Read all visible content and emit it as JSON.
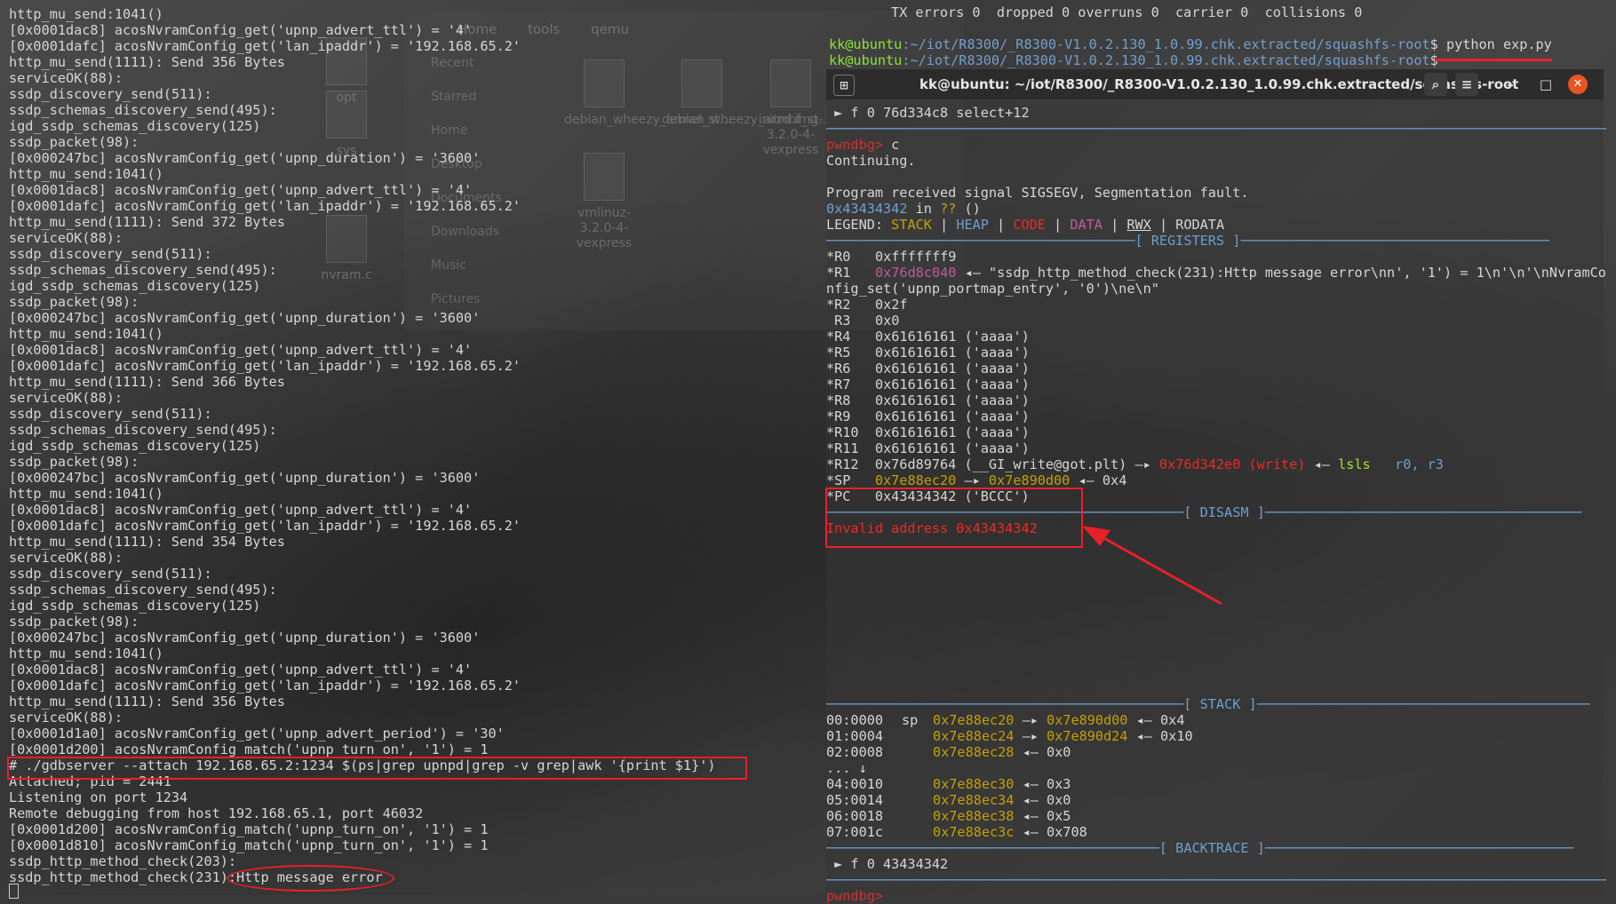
{
  "background_file_manager": {
    "tabs": [
      "Home",
      "tools",
      "qemu"
    ],
    "sidebar": [
      "Recent",
      "Starred",
      "Home",
      "Desktop",
      "Documents",
      "Downloads",
      "Music",
      "Pictures"
    ],
    "files": [
      {
        "name": "opt"
      },
      {
        "name": "sys"
      },
      {
        "name": "debian_wheezy_armel_st..."
      },
      {
        "name": "debian_wheezy_armhf_st..."
      },
      {
        "name": "initrd.img-3.2.0-4-vexpress"
      },
      {
        "name": "vmlinuz-3.2.0-4-vexpress"
      },
      {
        "name": "nvram.c"
      }
    ]
  },
  "left_terminal": {
    "lines": [
      "http_mu_send:1041()",
      "[0x0001dac8] acosNvramConfig_get('upnp_advert_ttl') = '4'",
      "[0x0001dafc] acosNvramConfig_get('lan_ipaddr') = '192.168.65.2'",
      "http_mu_send(1111): Send 356 Bytes",
      "serviceOK(88):",
      "ssdp_discovery_send(511):",
      "ssdp_schemas_discovery_send(495):",
      "igd_ssdp_schemas_discovery(125)",
      "ssdp_packet(98):",
      "[0x000247bc] acosNvramConfig_get('upnp_duration') = '3600'",
      "http_mu_send:1041()",
      "[0x0001dac8] acosNvramConfig_get('upnp_advert_ttl') = '4'",
      "[0x0001dafc] acosNvramConfig_get('lan_ipaddr') = '192.168.65.2'",
      "http_mu_send(1111): Send 372 Bytes",
      "serviceOK(88):",
      "ssdp_discovery_send(511):",
      "ssdp_schemas_discovery_send(495):",
      "igd_ssdp_schemas_discovery(125)",
      "ssdp_packet(98):",
      "[0x000247bc] acosNvramConfig_get('upnp_duration') = '3600'",
      "http_mu_send:1041()",
      "[0x0001dac8] acosNvramConfig_get('upnp_advert_ttl') = '4'",
      "[0x0001dafc] acosNvramConfig_get('lan_ipaddr') = '192.168.65.2'",
      "http_mu_send(1111): Send 366 Bytes",
      "serviceOK(88):",
      "ssdp_discovery_send(511):",
      "ssdp_schemas_discovery_send(495):",
      "igd_ssdp_schemas_discovery(125)",
      "ssdp_packet(98):",
      "[0x000247bc] acosNvramConfig_get('upnp_duration') = '3600'",
      "http_mu_send:1041()",
      "[0x0001dac8] acosNvramConfig_get('upnp_advert_ttl') = '4'",
      "[0x0001dafc] acosNvramConfig_get('lan_ipaddr') = '192.168.65.2'",
      "http_mu_send(1111): Send 354 Bytes",
      "serviceOK(88):",
      "ssdp_discovery_send(511):",
      "ssdp_schemas_discovery_send(495):",
      "igd_ssdp_schemas_discovery(125)",
      "ssdp_packet(98):",
      "[0x000247bc] acosNvramConfig_get('upnp_duration') = '3600'",
      "http_mu_send:1041()",
      "[0x0001dac8] acosNvramConfig_get('upnp_advert_ttl') = '4'",
      "[0x0001dafc] acosNvramConfig_get('lan_ipaddr') = '192.168.65.2'",
      "http_mu_send(1111): Send 356 Bytes",
      "serviceOK(88):",
      "[0x0001d1a0] acosNvramConfig_get('upnp_advert_period') = '30'",
      "[0x0001d200] acosNvramConfig_match('upnp_turn_on', '1') = 1",
      "# ./gdbserver --attach 192.168.65.2:1234 $(ps|grep upnpd|grep -v grep|awk '{print $1}')",
      "Attached; pid = 2441",
      "Listening on port 1234",
      "Remote debugging from host 192.168.65.1, port 46032",
      "[0x0001d200] acosNvramConfig_match('upnp_turn_on', '1') = 1",
      "[0x0001d810] acosNvramConfig_match('upnp_turn_on', '1') = 1",
      "ssdp_http_method_check(203):",
      "ssdp_http_method_check(231):Http message error"
    ]
  },
  "right_terminal": {
    "top_lines": [
      "TX errors 0  dropped 0 overruns 0  carrier 0  collisions 0",
      "",
      "kk@ubuntu:~/iot/R8300/_R8300-V1.0.2.130_1.0.99.chk.extracted/squashfs-root$ python exp.py",
      "kk@ubuntu:~/iot/R8300/_R8300-V1.0.2.130_1.0.99.chk.extracted/squashfs-root$"
    ],
    "prompt_user": "kk@ubuntu",
    "prompt_path": ":~/iot/R8300/_R8300-V1.0.2.130_1.0.99.chk.extracted/squashfs-root",
    "command": "python exp.py",
    "window_title": "kk@ubuntu: ~/iot/R8300/_R8300-V1.0.2.130_1.0.99.chk.extracted/squashfs-root",
    "frame_line": " ► f 0 76d334c8 select+12",
    "pwndbg_prompt": "pwndbg>",
    "continue_cmd": "c",
    "continuing": "Continuing.",
    "signal": "Program received signal SIGSEGV, Segmentation fault.",
    "fault_addr": "0x43434342",
    "fault_in": " in ",
    "fault_qq": "??",
    "fault_paren": " ()",
    "legend_label": "LEGEND: ",
    "legend": [
      "STACK",
      "HEAP",
      "CODE",
      "DATA",
      "RWX",
      "RODATA"
    ],
    "sections": {
      "registers": "[ REGISTERS ]",
      "disasm": "[ DISASM ]",
      "stack": "[ STACK ]",
      "backtrace": "[ BACKTRACE ]"
    },
    "registers": [
      {
        "name": "*R0",
        "value": "0xfffffff9",
        "rest": ""
      },
      {
        "name": "*R1",
        "value": "0x76d8c040",
        "rest": " ◂— \"ssdp_http_method_check(231):Http message error\\nn', '1') = 1\\n'\\n'\\nNvramCo"
      },
      {
        "name": "",
        "value": "",
        "rest": "nfig_set('upnp_portmap_entry', '0')\\ne\\n\""
      },
      {
        "name": "*R2",
        "value": "0x2f",
        "rest": ""
      },
      {
        "name": " R3",
        "value": "0x0",
        "rest": ""
      },
      {
        "name": "*R4",
        "value": "0x61616161",
        "rest": " ('aaaa')"
      },
      {
        "name": "*R5",
        "value": "0x61616161",
        "rest": " ('aaaa')"
      },
      {
        "name": "*R6",
        "value": "0x61616161",
        "rest": " ('aaaa')"
      },
      {
        "name": "*R7",
        "value": "0x61616161",
        "rest": " ('aaaa')"
      },
      {
        "name": "*R8",
        "value": "0x61616161",
        "rest": " ('aaaa')"
      },
      {
        "name": "*R9",
        "value": "0x61616161",
        "rest": " ('aaaa')"
      },
      {
        "name": "*R10",
        "value": "0x61616161",
        "rest": " ('aaaa')"
      },
      {
        "name": "*R11",
        "value": "0x61616161",
        "rest": " ('aaaa')"
      }
    ],
    "r12": {
      "name": "*R12",
      "value": "0x76d89764",
      "sym": " (__GI_write@got.plt) —▸ ",
      "target": "0x76d342e0 (write)",
      "arrow": " ◂— ",
      "insn": "lsls",
      "ops": "   r0, r3"
    },
    "sp": {
      "name": "*SP",
      "a": "0x7e88ec20",
      "arrow": " —▸ ",
      "b": "0x7e890d00",
      "rest": " ◂— 0x4"
    },
    "pc": {
      "name": "*PC",
      "value": "0x43434342",
      "rest": " ('BCCC')"
    },
    "disasm_error": "Invalid address 0x43434342",
    "stack": [
      {
        "off": "00:0000",
        "tag": "sp",
        "addr": "0x7e88ec20",
        "ptr": "0x7e890d00",
        "val": "0x4"
      },
      {
        "off": "01:0004",
        "tag": "",
        "addr": "0x7e88ec24",
        "ptr": "0x7e890d24",
        "val": "0x10"
      },
      {
        "off": "02:0008",
        "tag": "",
        "addr": "0x7e88ec28",
        "ptr": "",
        "val": "0x0"
      },
      {
        "off": "... ↓",
        "tag": "",
        "addr": "",
        "ptr": "",
        "val": ""
      },
      {
        "off": "04:0010",
        "tag": "",
        "addr": "0x7e88ec30",
        "ptr": "",
        "val": "0x3"
      },
      {
        "off": "05:0014",
        "tag": "",
        "addr": "0x7e88ec34",
        "ptr": "",
        "val": "0x0"
      },
      {
        "off": "06:0018",
        "tag": "",
        "addr": "0x7e88ec38",
        "ptr": "",
        "val": "0x5"
      },
      {
        "off": "07:001c",
        "tag": "",
        "addr": "0x7e88ec3c",
        "ptr": "",
        "val": "0x708"
      }
    ],
    "backtrace_line": " ► f 0 43434342",
    "bottom_prompt": "pwndbg>"
  },
  "colors": {
    "prompt_user": "#8ae234",
    "prompt_path": "#729fcf",
    "highlight": "#e8202a",
    "register_ptr": "#c45a9a",
    "stack_addr": "#c4a000",
    "section": "#6f9fcf"
  },
  "icons": [
    "new-tab-icon",
    "search-icon",
    "hamburger-menu-icon",
    "minimize-icon",
    "maximize-icon",
    "close-icon"
  ]
}
